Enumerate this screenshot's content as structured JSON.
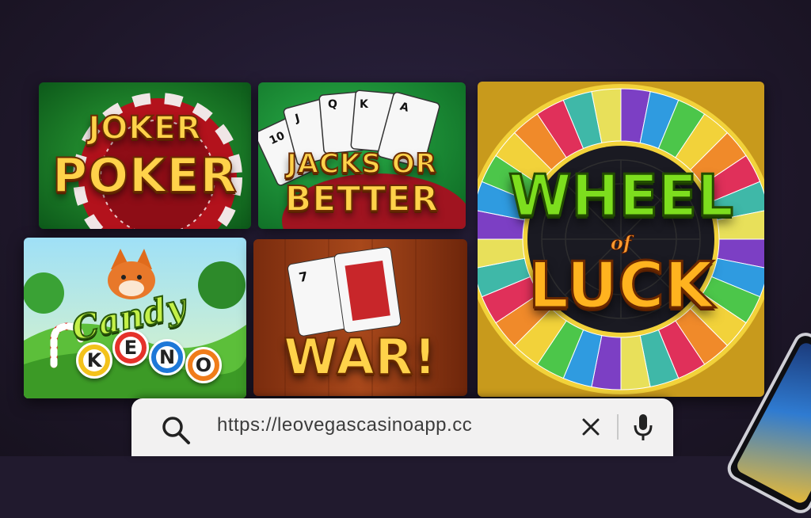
{
  "games": [
    {
      "id": "joker-poker",
      "title_line1": "JOKER",
      "title_line2": "POKER"
    },
    {
      "id": "jacks-or-better",
      "title_line1": "JACKS OR",
      "title_line2": "BETTER"
    },
    {
      "id": "candy-keno",
      "title_line1": "Candy",
      "balls": [
        "K",
        "E",
        "N",
        "O"
      ]
    },
    {
      "id": "war",
      "title_line1": "WAR!"
    },
    {
      "id": "wheel-of-luck",
      "title_line1": "WHEEL",
      "title_line2": "of",
      "title_line3": "LUCK"
    }
  ],
  "search": {
    "url": "https://leovegascasinoapp.cc"
  },
  "colors": {
    "background": "#211a2e",
    "title_gold": "#ffd24a",
    "wheel_green": "#7dde1e",
    "felt_green": "#1f8a2c"
  },
  "icons": {
    "search": "search-icon",
    "clear": "close-icon",
    "voice": "microphone-icon"
  }
}
